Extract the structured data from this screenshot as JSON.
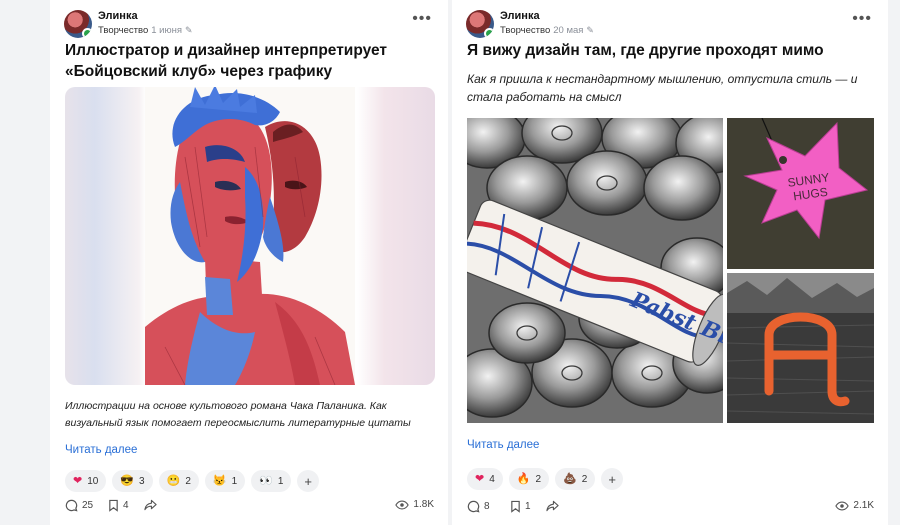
{
  "posts": [
    {
      "author": "Элинка",
      "category": "Творчество",
      "date": "1 июня",
      "title": "Иллюстратор и дизайнер интерпретирует «Бойцовский клуб» через графику",
      "description": "Иллюстрации на основе культового романа Чака Паланика. Как визуальный язык помогает переосмыслить литературные цитаты",
      "read_more": "Читать далее",
      "reactions": [
        {
          "icon": "heart",
          "count": "10"
        },
        {
          "icon": "sunglasses-face",
          "count": "3"
        },
        {
          "icon": "grimacing-face",
          "count": "2"
        },
        {
          "icon": "angry-cat-face",
          "count": "1"
        },
        {
          "icon": "eyes",
          "count": "1"
        }
      ],
      "add_reaction": "+",
      "comments": "25",
      "bookmarks": "4",
      "views": "1.8K"
    },
    {
      "author": "Элинка",
      "category": "Творчество",
      "date": "20 мая",
      "title": "Я вижу дизайн там, где другие проходят мимо",
      "subtitle": "Как я пришла к нестандартному мышлению, отпустила стиль — и стала работать на смысл",
      "read_more": "Читать далее",
      "reactions": [
        {
          "icon": "heart",
          "count": "4"
        },
        {
          "icon": "fire",
          "count": "2"
        },
        {
          "icon": "poop",
          "count": "2"
        }
      ],
      "add_reaction": "+",
      "comments": "8",
      "bookmarks": "1",
      "views": "2.1K",
      "images": {
        "can_text": "Pabst Blue Ribbon BEER",
        "star_text_1": "SUNNY",
        "star_text_2": "HUGS",
        "letter": "A"
      }
    }
  ],
  "colors": {
    "link": "#2a6fd6",
    "heart": "#e0245e",
    "portrait_blue": "#3f6fd6",
    "portrait_red": "#d6505a",
    "star_pink": "#f25fc4",
    "letter_orange": "#e8622f"
  }
}
